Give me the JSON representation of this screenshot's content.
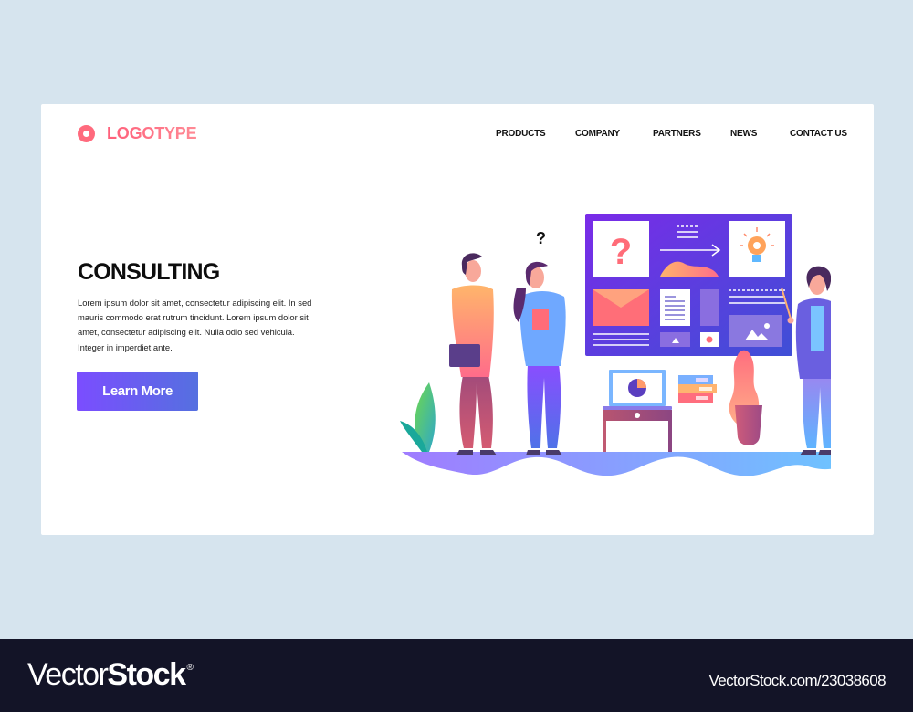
{
  "header": {
    "logo_text": "LOGOTYPE",
    "logo_icon": "ring-logo-icon",
    "nav": [
      {
        "label": "PRODUCTS"
      },
      {
        "label": "COMPANY"
      },
      {
        "label": "PARTNERS"
      },
      {
        "label": "NEWS"
      },
      {
        "label": "CONTACT US"
      }
    ]
  },
  "hero": {
    "title": "CONSULTING",
    "body": "Lorem ipsum dolor sit amet, consectetur adipiscing elit. In sed mauris commodo erat rutrum tincidunt. Lorem ipsum dolor sit amet, consectetur adipiscing elit. Nulla  odio sed vehicula. Integer in imperdiet ante.",
    "cta_label": "Learn More"
  },
  "illustration": {
    "question_mark": "?",
    "board_question": "?",
    "theme": "consulting team presenting at a board"
  },
  "colors": {
    "accent_logo": "#ff6a7d",
    "cta_start": "#7b4dff",
    "cta_end": "#5570e0",
    "page_bg": "#d6e4ee",
    "footer_bg": "#131427"
  },
  "footer": {
    "brand_light": "Vector",
    "brand_bold": "Stock",
    "brand_mark": "®",
    "url": "VectorStock.com/23038608"
  }
}
